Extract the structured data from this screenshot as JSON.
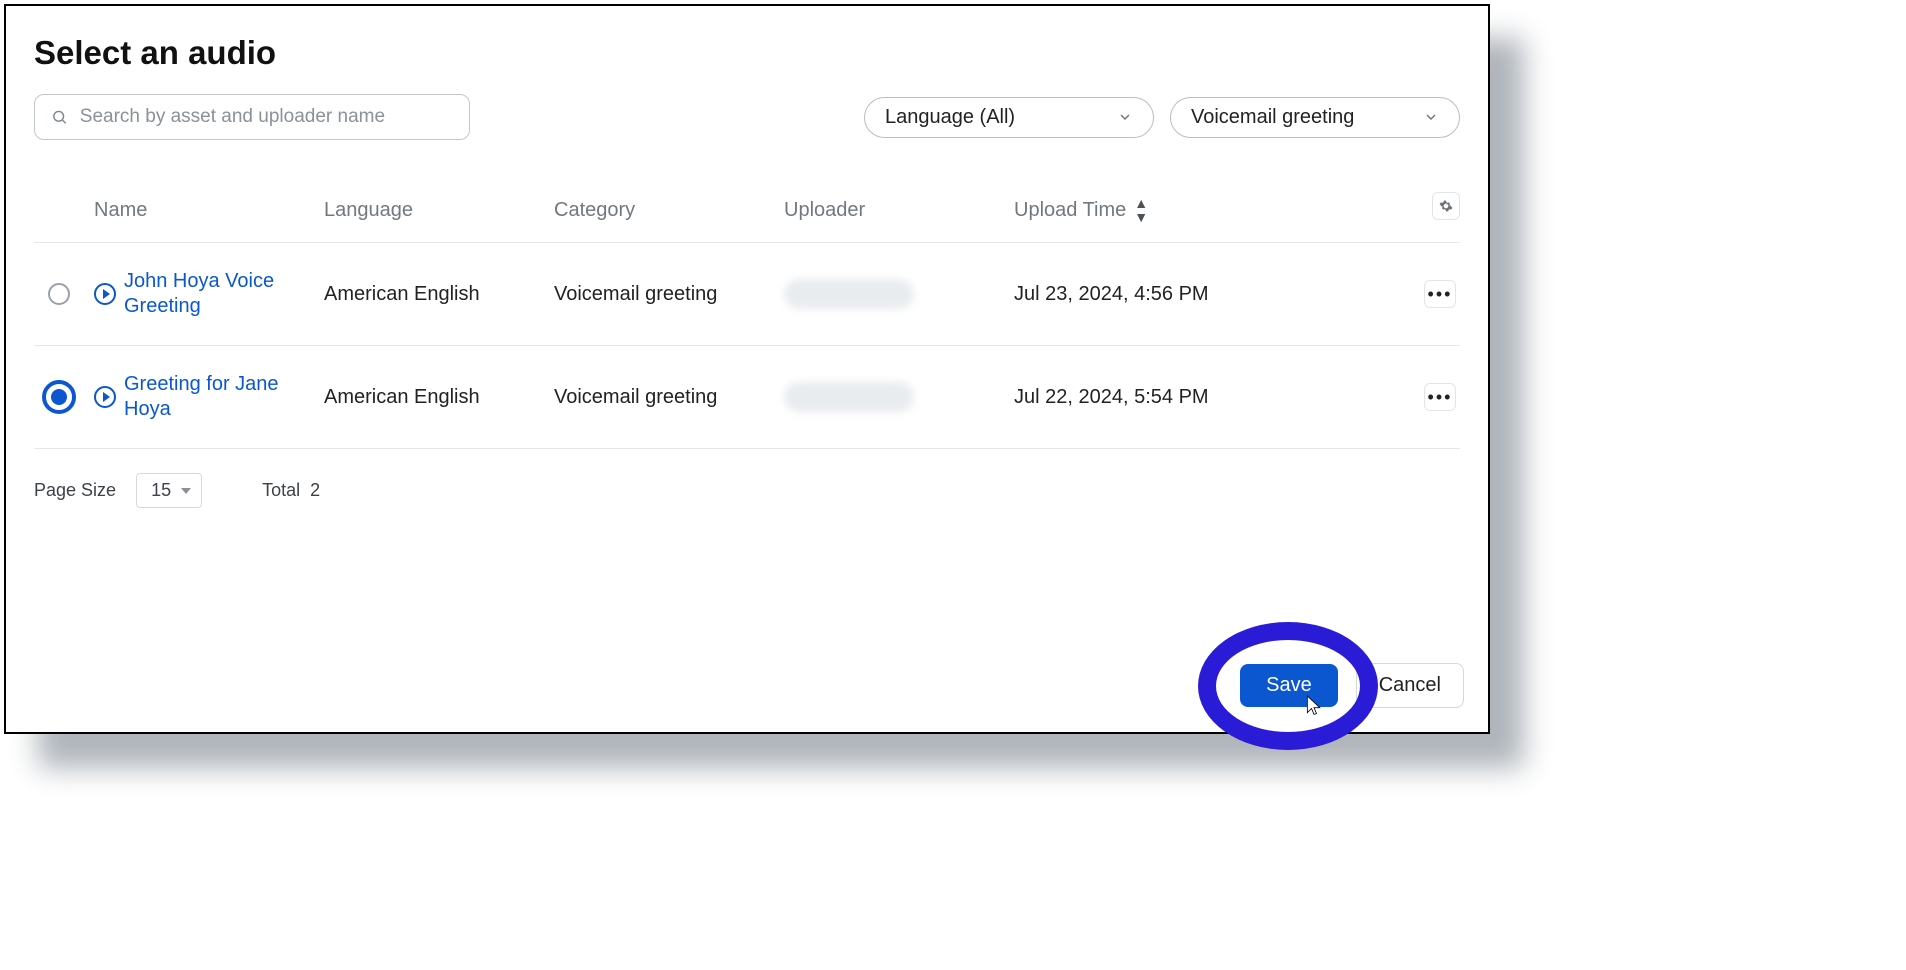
{
  "title": "Select an audio",
  "search": {
    "placeholder": "Search by asset and uploader name"
  },
  "filters": {
    "language_label": "Language (All)",
    "category_label": "Voicemail greeting"
  },
  "columns": {
    "name": "Name",
    "language": "Language",
    "category": "Category",
    "uploader": "Uploader",
    "upload_time": "Upload Time"
  },
  "rows": [
    {
      "selected": false,
      "name": "John Hoya Voice Greeting",
      "language": "American English",
      "category": "Voicemail greeting",
      "uploader": "",
      "upload_time": "Jul 23, 2024, 4:56 PM"
    },
    {
      "selected": true,
      "name": "Greeting for Jane Hoya",
      "language": "American English",
      "category": "Voicemail greeting",
      "uploader": "",
      "upload_time": "Jul 22, 2024, 5:54 PM"
    }
  ],
  "pagination": {
    "page_size_label": "Page Size",
    "page_size_value": "15",
    "total_label": "Total",
    "total_value": "2"
  },
  "actions": {
    "save": "Save",
    "cancel": "Cancel"
  }
}
